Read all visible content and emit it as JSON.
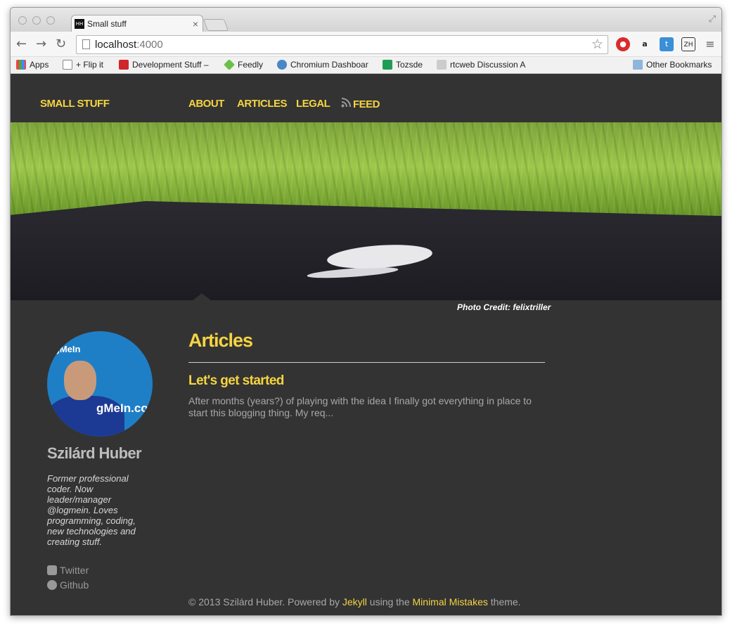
{
  "browser": {
    "tab_title": "Small stuff",
    "tab_favicon": "HH",
    "url_host": "localhost",
    "url_port": ":4000",
    "bookmarks": [
      {
        "label": "Apps",
        "icon": "apps-grid-icon"
      },
      {
        "label": "+ Flip it",
        "icon": "page-icon"
      },
      {
        "label": "Development Stuff –",
        "icon": "flipboard-icon"
      },
      {
        "label": "Feedly",
        "icon": "feedly-icon"
      },
      {
        "label": "Chromium Dashboar",
        "icon": "chromium-icon"
      },
      {
        "label": "Tozsde",
        "icon": "sheet-icon"
      },
      {
        "label": "rtcweb Discussion A",
        "icon": "mail-icon"
      }
    ],
    "other_bookmarks": "Other Bookmarks",
    "ext_zh": "ZH"
  },
  "site": {
    "brand": "SMALL STUFF",
    "nav": [
      "ABOUT",
      "ARTICLES",
      "LEGAL",
      "FEED"
    ],
    "photo_credit": "Photo Credit: felixtriller",
    "avatar_text1": "LogMeIn",
    "avatar_text2": "gMeIn.co"
  },
  "author": {
    "name": "Szilárd Huber",
    "bio": "Former professional coder. Now leader/manager @logmein. Loves programming, coding, new technologies and creating stuff.",
    "social": [
      "Twitter",
      "Github"
    ]
  },
  "main": {
    "heading": "Articles",
    "post_title": "Let's get started",
    "post_excerpt": "After months (years?) of playing with the idea I finally got everything in place to start this blogging thing. My req..."
  },
  "footer": {
    "prefix": "© 2013 Szilárd Huber. Powered by ",
    "jekyll": "Jekyll",
    "middle": " using the ",
    "theme": "Minimal Mistakes",
    "suffix": " theme."
  },
  "colors": {
    "accent": "#f5d442",
    "page_bg": "#333333"
  }
}
